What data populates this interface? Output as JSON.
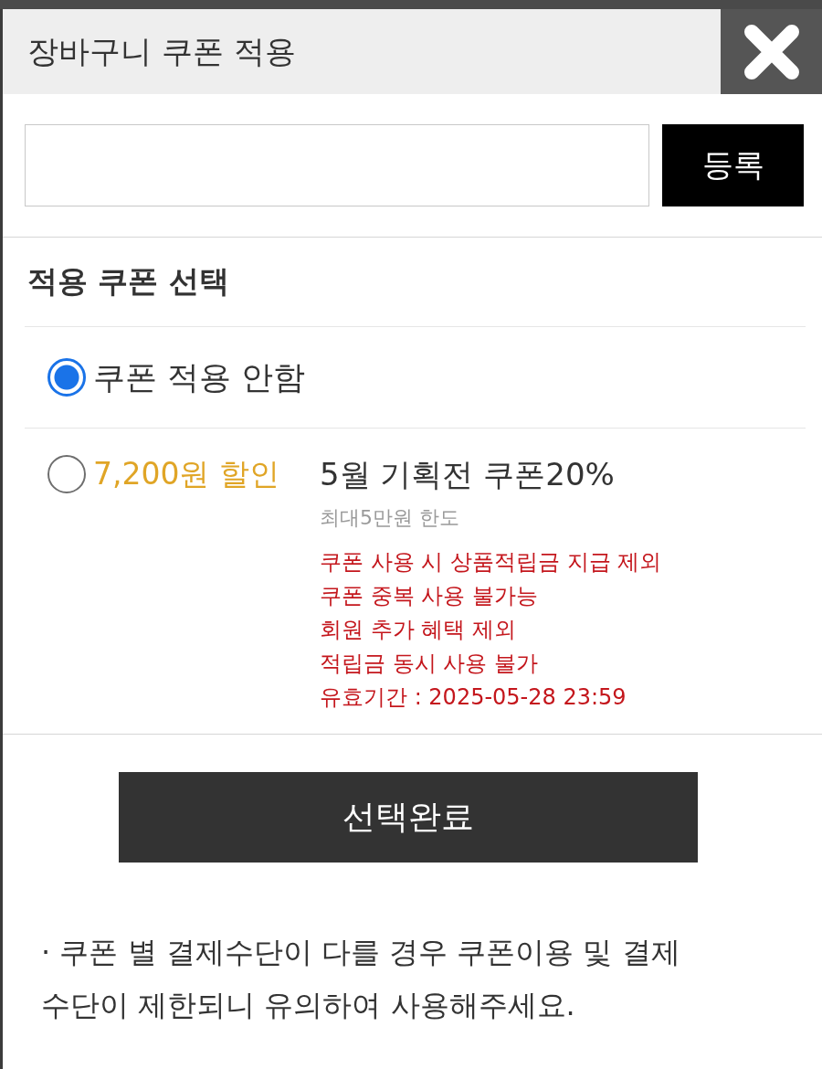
{
  "header": {
    "title": "장바구니 쿠폰 적용"
  },
  "coupon_code": {
    "button": "등록"
  },
  "section": {
    "title": "적용 쿠폰 선택"
  },
  "options": [
    {
      "kind": "none",
      "label": "쿠폰 적용 안함",
      "selected": true
    },
    {
      "kind": "coupon",
      "discount": "7,200원 할인",
      "name": "5월 기획전 쿠폰20%",
      "limit": "최대5만원 한도",
      "notes": [
        "쿠폰 사용 시 상품적립금 지급 제외",
        "쿠폰 중복 사용 불가능",
        "회원 추가 혜택 제외",
        "적립금 동시 사용 불가",
        "유효기간 : 2025-05-28 23:59"
      ],
      "selected": false
    }
  ],
  "confirm_button": "선택완료",
  "notice": "· 쿠폰 별 결제수단이 다를 경우 쿠폰이용 및 결제 수단이 제한되니 유의하여 사용해주세요."
}
